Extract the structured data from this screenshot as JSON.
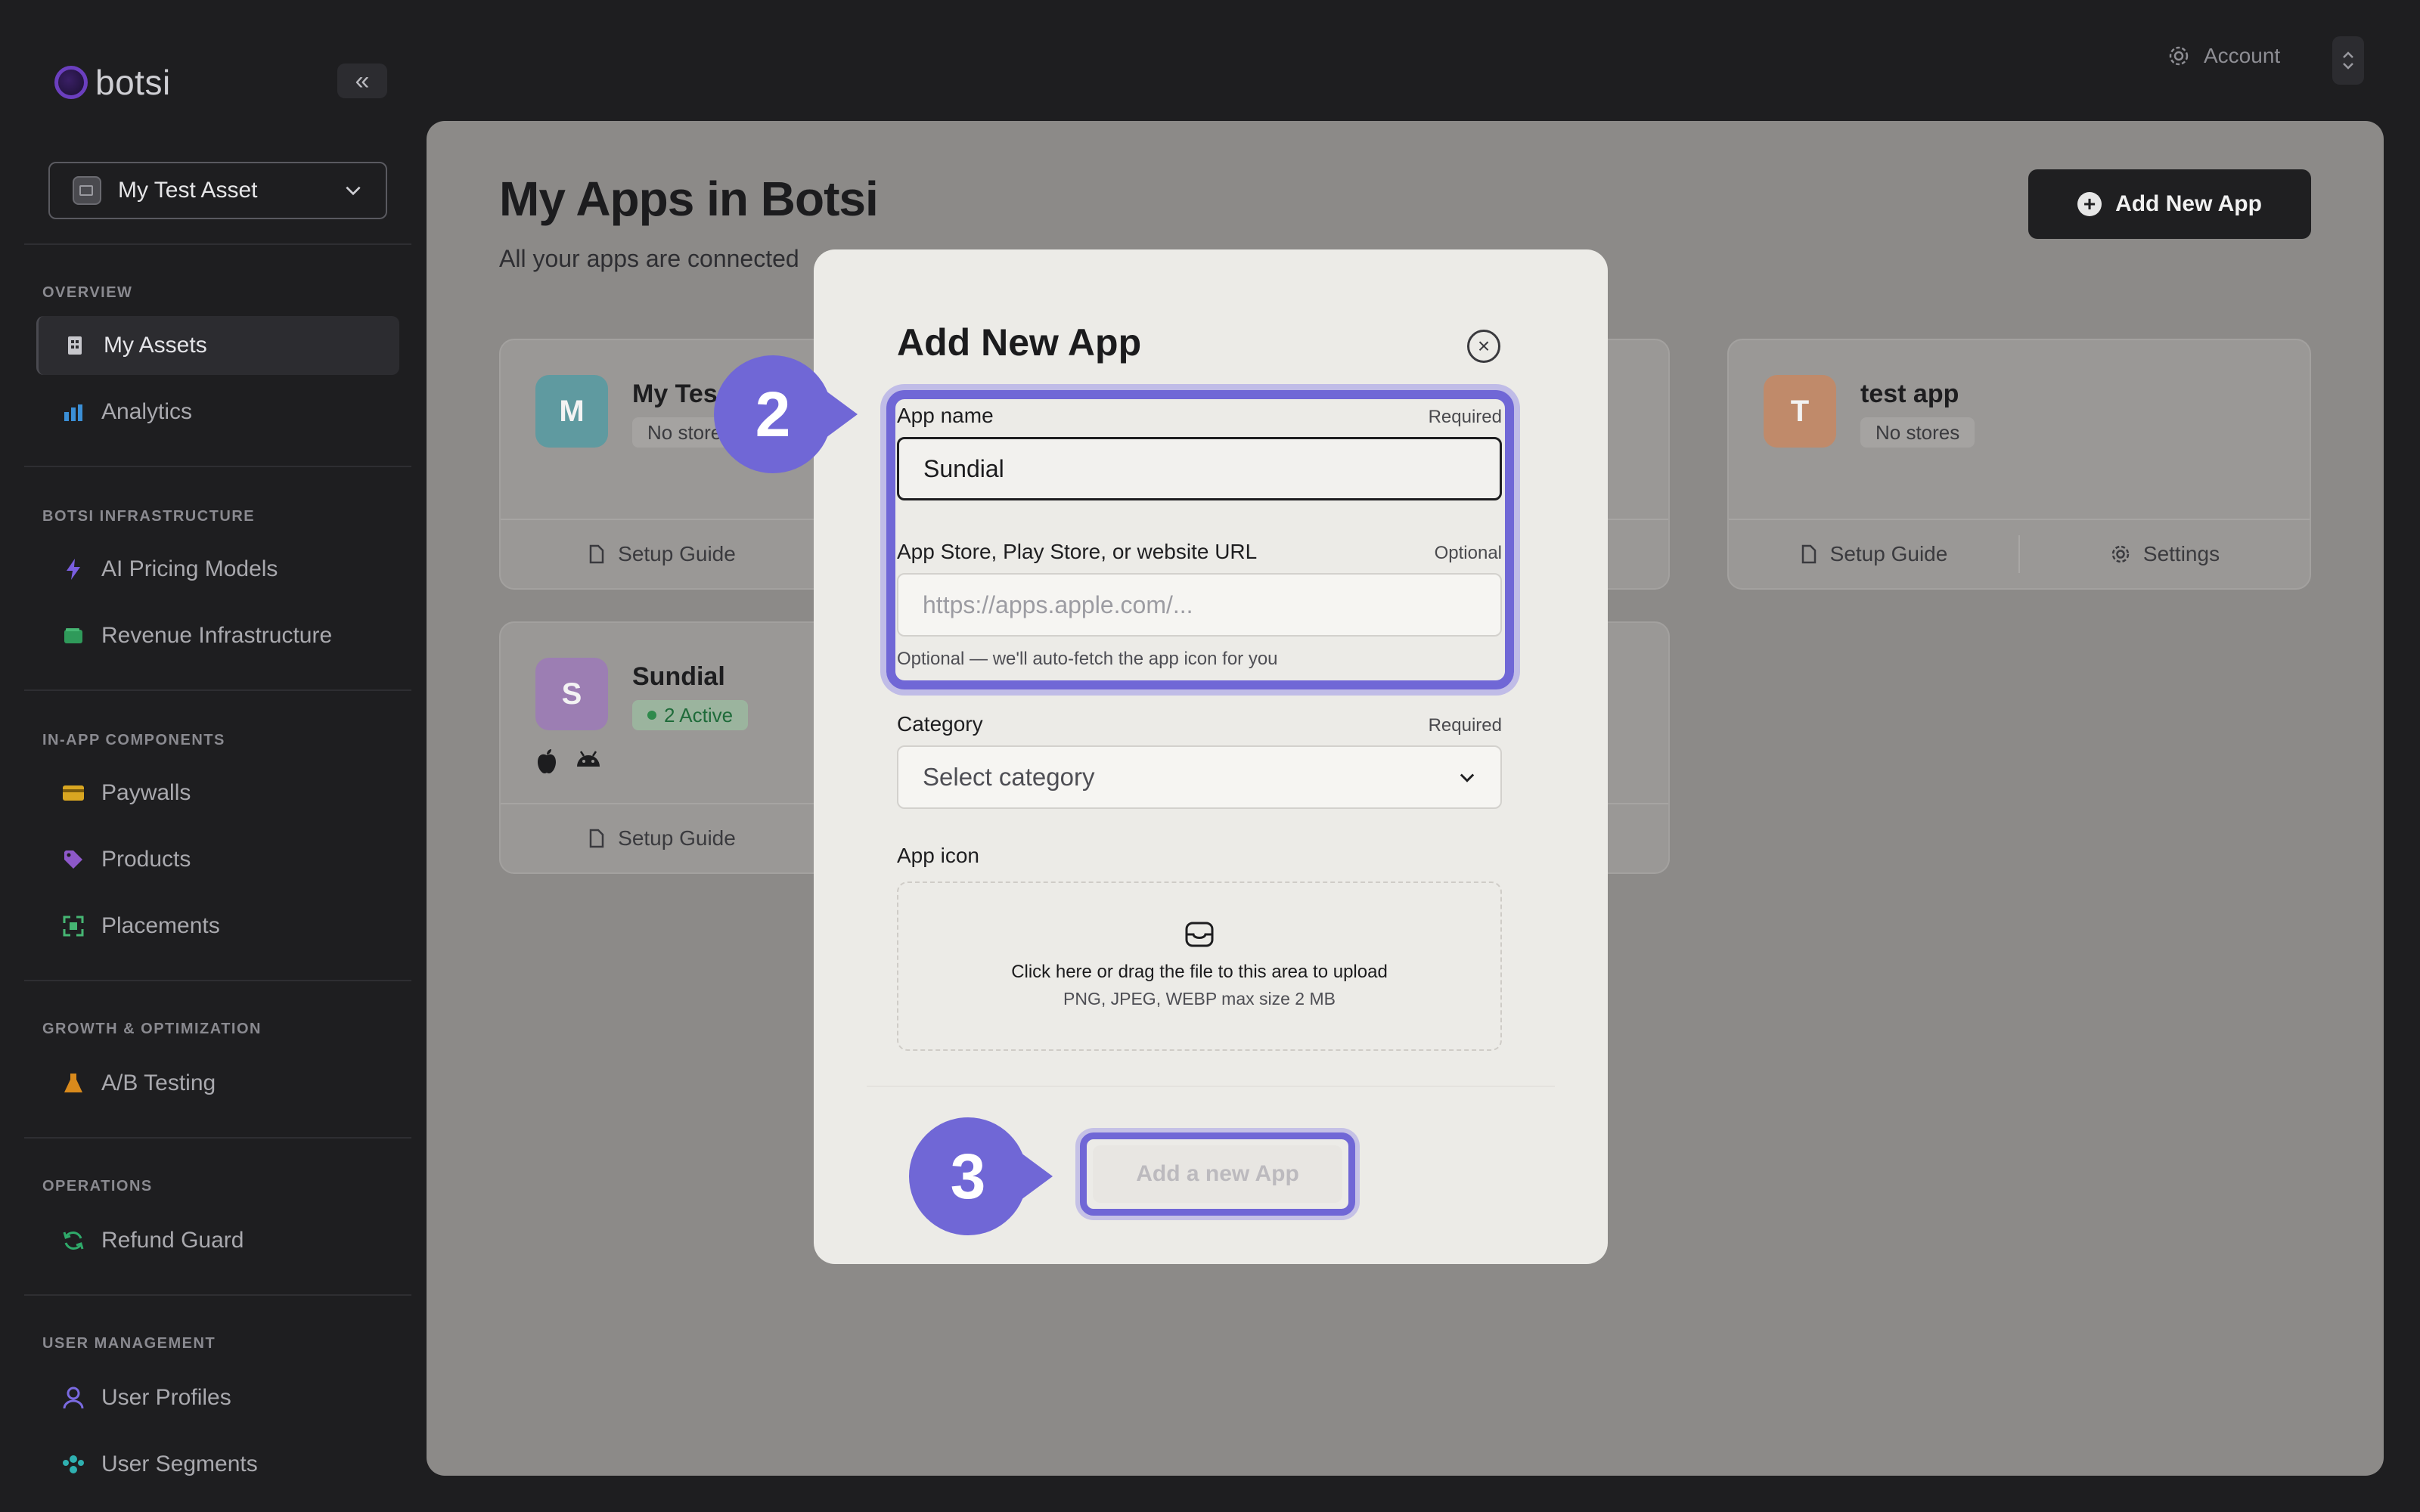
{
  "app": {
    "logo_text": "botsi"
  },
  "sidebar": {
    "asset_selector": "My Test Asset",
    "sections": [
      {
        "title": "OVERVIEW",
        "items": [
          {
            "label": "My Assets"
          },
          {
            "label": "Analytics"
          }
        ]
      },
      {
        "title": "BOTSI INFRASTRUCTURE",
        "items": [
          {
            "label": "AI Pricing Models"
          },
          {
            "label": "Revenue Infrastructure"
          }
        ]
      },
      {
        "title": "IN-APP COMPONENTS",
        "items": [
          {
            "label": "Paywalls"
          },
          {
            "label": "Products"
          },
          {
            "label": "Placements"
          }
        ]
      },
      {
        "title": "GROWTH & OPTIMIZATION",
        "items": [
          {
            "label": "A/B Testing"
          }
        ]
      },
      {
        "title": "OPERATIONS",
        "items": [
          {
            "label": "Refund Guard"
          }
        ]
      },
      {
        "title": "USER MANAGEMENT",
        "items": [
          {
            "label": "User Profiles"
          },
          {
            "label": "User Segments"
          }
        ]
      }
    ]
  },
  "header": {
    "account_label": "Account"
  },
  "main": {
    "title": "My Apps in Botsi",
    "subtitle": "All your apps are connected",
    "add_button": "Add New App",
    "cards": [
      {
        "initial": "M",
        "name": "My Tes",
        "badge": "No store",
        "btn1": "Setup Guide",
        "color": "#5f9aa0"
      },
      {
        "initial": "T",
        "name": "test app",
        "badge": "No stores",
        "btn1": "Setup Guide",
        "btn2": "Settings",
        "color": "#c08a6a"
      },
      {
        "initial": "S",
        "name": "Sundial",
        "badge": "2 Active",
        "btn1": "Setup Guide",
        "color": "#9c7eb3"
      }
    ]
  },
  "modal": {
    "title": "Add New App",
    "app_name": {
      "label": "App name",
      "req": "Required",
      "value": "Sundial"
    },
    "url": {
      "label": "App Store, Play Store, or website URL",
      "req": "Optional",
      "placeholder": "https://apps.apple.com/...",
      "hint": "Optional — we'll auto-fetch the app icon for you"
    },
    "category": {
      "label": "Category",
      "req": "Required",
      "placeholder": "Select category"
    },
    "icon": {
      "label": "App icon",
      "upload_title": "Click here or drag the file to this area to upload",
      "upload_sub": "PNG, JPEG, WEBP max size 2 MB"
    },
    "submit": "Add a new App"
  },
  "steps": {
    "step2": "2",
    "step3": "3"
  },
  "colors": {
    "accent": "#7067d6",
    "brand": "#6b3fbf"
  }
}
